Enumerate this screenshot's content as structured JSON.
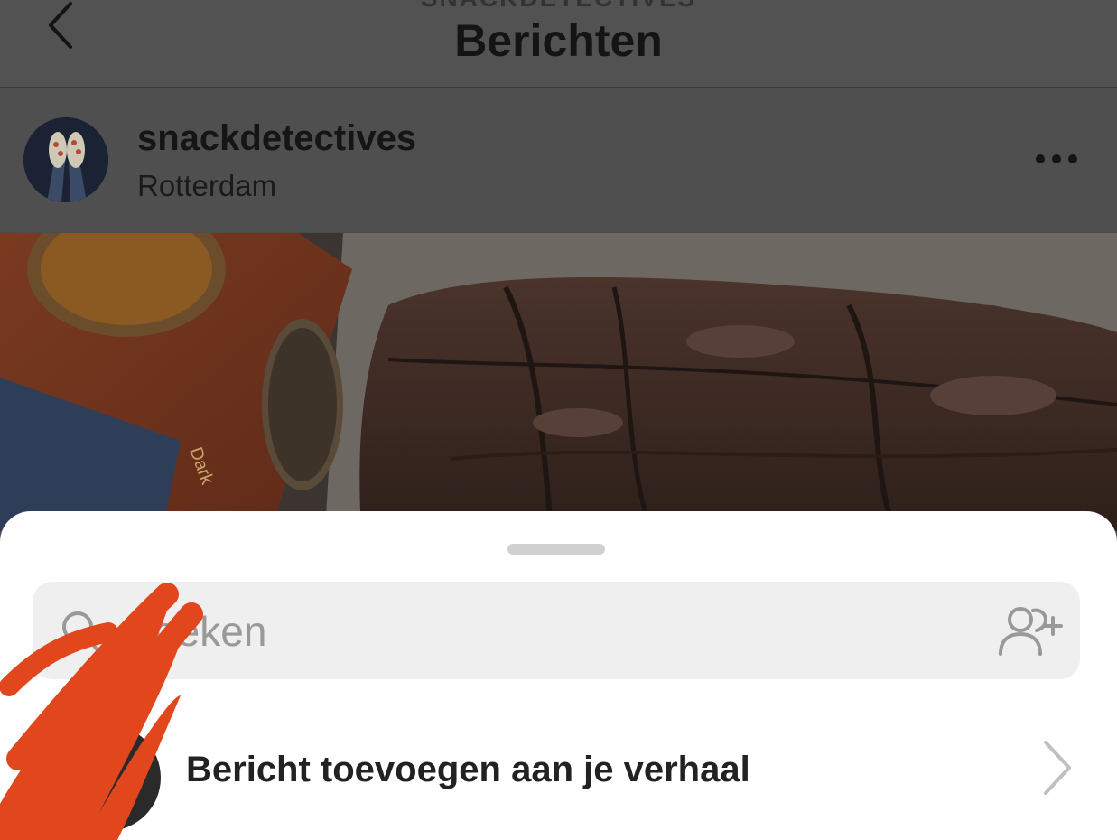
{
  "nav": {
    "account_label": "SNACKDETECTIVES",
    "title": "Berichten",
    "back_icon": "chevron-left-icon"
  },
  "post": {
    "username": "snackdetectives",
    "location": "Rotterdam",
    "more_icon": "ellipsis-icon"
  },
  "photo": {
    "box_text": "Dark"
  },
  "share_sheet": {
    "search_placeholder": "Zoeken",
    "search_icon": "search-icon",
    "add_people_icon": "add-people-icon",
    "story_action_label": "Bericht toevoegen aan je verhaal",
    "chevron_icon": "chevron-right-icon"
  },
  "colors": {
    "dim_overlay": "#4c4c4c",
    "sheet_background": "#ffffff",
    "search_background": "#efefef",
    "scribble": "#e2461c"
  }
}
